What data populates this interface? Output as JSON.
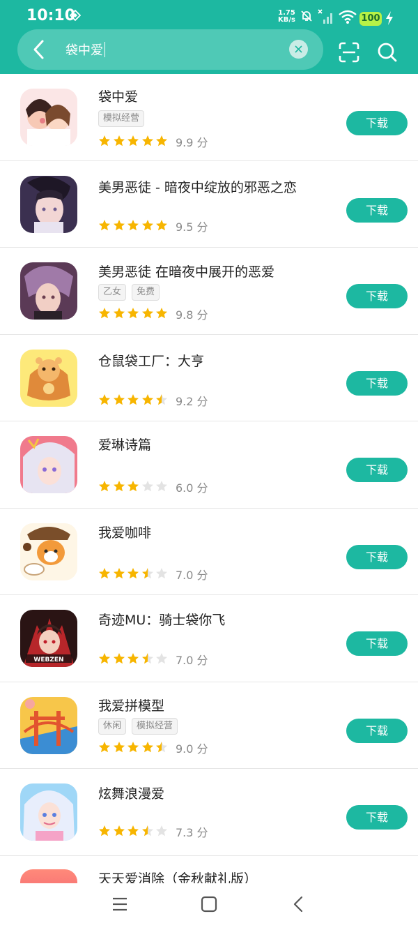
{
  "status": {
    "time": "10:10",
    "speed_value": "1.75",
    "speed_unit": "KB/s",
    "battery": "100"
  },
  "search": {
    "query": "袋中爱"
  },
  "download_label": "下载",
  "score_suffix": "分",
  "apps": [
    {
      "name": "袋中爱",
      "tags": [
        "模拟经营"
      ],
      "rating": 5,
      "score": "9.9"
    },
    {
      "name": "美男恶徒 - 暗夜中绽放的邪恶之恋",
      "tags": [],
      "rating": 5,
      "score": "9.5"
    },
    {
      "name": "美男恶徒 在暗夜中展开的恶爱",
      "tags": [
        "乙女",
        "免费"
      ],
      "rating": 5,
      "score": "9.8"
    },
    {
      "name": "仓鼠袋工厂：大亨",
      "tags": [],
      "rating": 4.5,
      "score": "9.2"
    },
    {
      "name": "爱琳诗篇",
      "tags": [],
      "rating": 3,
      "score": "6.0"
    },
    {
      "name": "我爱咖啡",
      "tags": [],
      "rating": 3.5,
      "score": "7.0"
    },
    {
      "name": "奇迹MU：骑士袋你飞",
      "tags": [],
      "rating": 3.5,
      "score": "7.0"
    },
    {
      "name": "我爱拼模型",
      "tags": [
        "休闲",
        "模拟经营"
      ],
      "rating": 4.5,
      "score": "9.0"
    },
    {
      "name": "炫舞浪漫爱",
      "tags": [],
      "rating": 3.5,
      "score": "7.3"
    }
  ],
  "partial_app": {
    "name": "天天爱消除（金秋献礼版）"
  },
  "colors": {
    "accent": "#1db8a1",
    "star": "#f7b500",
    "star_empty": "#e3e3e3"
  },
  "icons": {
    "back": "back-arrow-icon",
    "clear": "clear-icon",
    "scan": "scan-icon",
    "search": "search-icon"
  }
}
